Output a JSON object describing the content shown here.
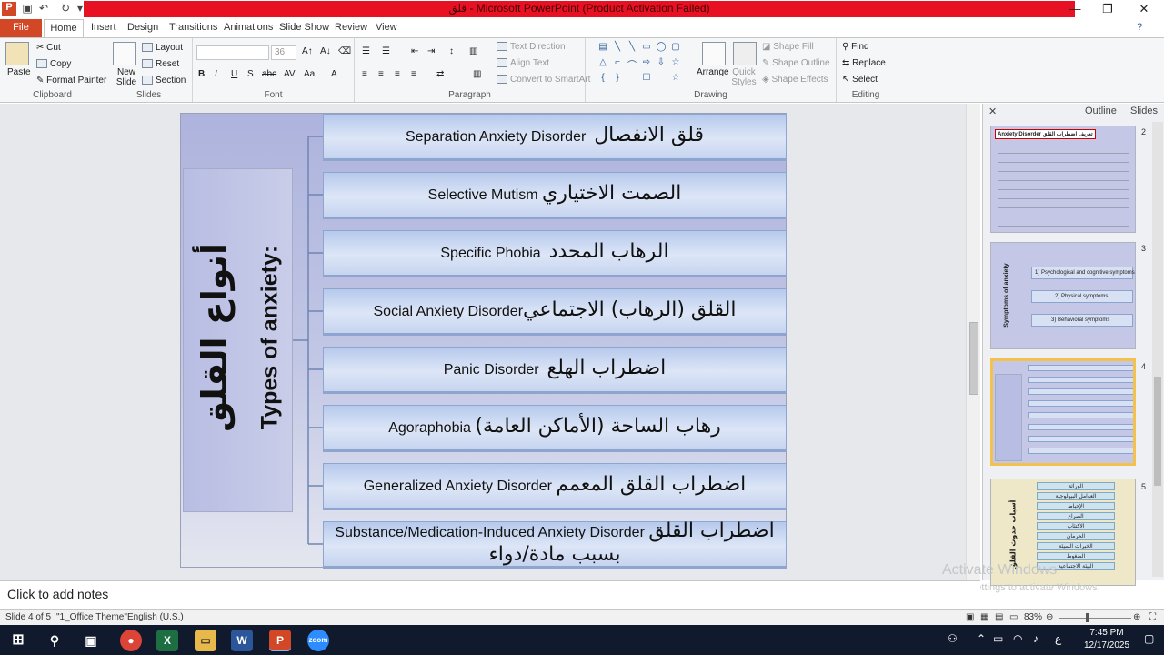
{
  "window": {
    "title": "قلق - Microsoft PowerPoint (Product Activation Failed)",
    "app_icon": "P",
    "controls": [
      "—",
      "❐",
      "✕"
    ]
  },
  "ribbon_tabs": [
    "File",
    "Home",
    "Insert",
    "Design",
    "Transitions",
    "Animations",
    "Slide Show",
    "Review",
    "View"
  ],
  "ribbon": {
    "clipboard": {
      "label": "Clipboard",
      "paste": "Paste",
      "cut": "Cut",
      "copy": "Copy",
      "format_painter": "Format Painter"
    },
    "slides": {
      "label": "Slides",
      "new_slide": "New Slide",
      "layout": "Layout",
      "reset": "Reset",
      "section": "Section"
    },
    "font": {
      "label": "Font",
      "size": "36",
      "buttons": [
        "B",
        "I",
        "U",
        "S",
        "abc",
        "AV",
        "Aa",
        "A"
      ]
    },
    "paragraph": {
      "label": "Paragraph",
      "text_direction": "Text Direction",
      "align_text": "Align Text",
      "convert_smartart": "Convert to SmartArt"
    },
    "drawing": {
      "label": "Drawing",
      "arrange": "Arrange",
      "quick_styles": "Quick Styles",
      "shape_fill": "Shape Fill",
      "shape_outline": "Shape Outline",
      "shape_effects": "Shape Effects"
    },
    "editing": {
      "label": "Editing",
      "find": "Find",
      "replace": "Replace",
      "select": "Select"
    }
  },
  "slide": {
    "side_title_ar": "أنواع القلق",
    "side_title_en": "Types of anxiety:",
    "items": [
      {
        "en": "Separation Anxiety Disorder",
        "ar": "قلق الانفصال"
      },
      {
        "en": "Selective Mutism",
        "ar": "الصمت الاختياري"
      },
      {
        "en": "Specific Phobia",
        "ar": "الرهاب المحدد"
      },
      {
        "en": "Social Anxiety Disorder",
        "ar": "القلق (الرهاب) الاجتماعي"
      },
      {
        "en": "Panic Disorder",
        "ar": "اضطراب الهلع"
      },
      {
        "en": "Agoraphobia",
        "ar": "رهاب الساحة (الأماكن العامة)"
      },
      {
        "en": "Generalized Anxiety Disorder",
        "ar": "اضطراب القلق المعمم"
      },
      {
        "en": "Substance/Medication-Induced Anxiety Disorder",
        "ar": "اضطراب القلق بسبب مادة/دواء"
      }
    ]
  },
  "pane": {
    "tabs": [
      "Outline",
      "Slides"
    ],
    "thumbnails": [
      {
        "num": "2",
        "title": "Anxiety Disorder",
        "title_ar": "تعريف اضطراب القلق"
      },
      {
        "num": "3",
        "title": "Symptoms of anxiety",
        "lines": [
          "1) Psychological and cognitive symptoms",
          "2) Physical symptoms",
          "3) Behavioral symptoms"
        ]
      },
      {
        "num": "4"
      },
      {
        "num": "5",
        "side": "أسباب حدوث القلق",
        "lines": [
          "الوراثة",
          "العوامل البيولوجية",
          "الإحباط",
          "الصراع",
          "الاكتئاب",
          "الحرمان",
          "الخبرات السيئة",
          "الضغوط",
          "البيئة الاجتماعية"
        ]
      }
    ]
  },
  "notes": {
    "placeholder": "Click to add notes"
  },
  "watermark": {
    "line1": "Activate Windows",
    "line2": "Go to Settings to activate Windows."
  },
  "status": {
    "slide": "Slide 4 of 5",
    "theme": "\"1_Office Theme\"",
    "language": "English (U.S.)",
    "zoom": "83%"
  },
  "taskbar": {
    "time": "7:45 PM",
    "date": "12/17/2025",
    "lang": "ع"
  }
}
